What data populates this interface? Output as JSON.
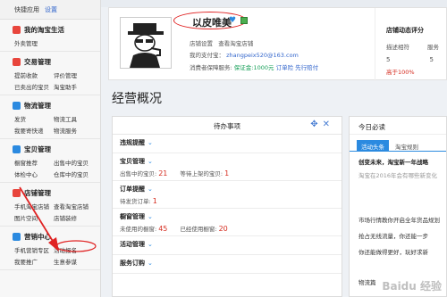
{
  "sidebar": {
    "quick_label": "快捷应用",
    "quick_link": "设置",
    "sections": [
      {
        "title": "我的淘宝生活",
        "color": "#e8453c",
        "items": [
          "外卖管理"
        ]
      },
      {
        "title": "交易管理",
        "color": "#e8453c",
        "items": [
          "提前收款",
          "评价管理",
          "已卖出的宝贝",
          "淘宝助手"
        ]
      },
      {
        "title": "物流管理",
        "color": "#2b8ae0",
        "items": [
          "发货",
          "物流工具",
          "我要寄快递",
          "物流服务"
        ]
      },
      {
        "title": "宝贝管理",
        "color": "#2b8ae0",
        "items": [
          "橱窗推荐",
          "出售中的宝贝",
          "体检中心",
          "仓库中的宝贝"
        ]
      },
      {
        "title": "店铺管理",
        "color": "#e8453c",
        "items": [
          "手机淘宝店铺",
          "查看淘宝店铺",
          "图片空间",
          "店铺装修"
        ]
      },
      {
        "title": "营销中心",
        "color": "#2b8ae0",
        "items": [
          "手机营销专区",
          "活动报名",
          "我要推广",
          "生意参谋"
        ]
      }
    ]
  },
  "profile": {
    "shop_name": "以皮唯美",
    "settings_link": "店铺设置",
    "view_shop_link": "查看淘宝店铺",
    "alipay_label": "我的支付宝：",
    "alipay_account": "zhangpeix520@163.com",
    "deposit_label": "消费者保障服务:",
    "deposit_value": "保证金:1000元",
    "return_label": "订单险",
    "fast_label": "先行赔付"
  },
  "rating": {
    "title": "店铺动态评分",
    "col1": "描述相符",
    "col2": "服务",
    "val1": "5",
    "val2": "5",
    "higher": "高于100%"
  },
  "main": {
    "title": "经营概况"
  },
  "todo": {
    "title": "待办事项",
    "sections": [
      {
        "title": "违规提醒",
        "rows": []
      },
      {
        "title": "宝贝管理",
        "rows": [
          {
            "label": "出售中的宝贝:",
            "value": "21"
          },
          {
            "label": "等待上架的宝贝:",
            "value": "1"
          }
        ]
      },
      {
        "title": "订单提醒",
        "rows": [
          {
            "label": "待发货订单:",
            "value": "1"
          }
        ]
      },
      {
        "title": "橱窗管理",
        "rows": [
          {
            "label": "未使用的橱窗:",
            "value": "45"
          },
          {
            "label": "已经使用橱窗:",
            "value": "20"
          }
        ]
      },
      {
        "title": "活动管理",
        "rows": []
      },
      {
        "title": "服务订购",
        "rows": []
      }
    ]
  },
  "knowledge": {
    "title": "今日必读",
    "tabs": [
      "活动头条",
      "淘宝规则"
    ],
    "lines": [
      "创变未来，淘宝新一年战略",
      "淘宝在2016年会有哪些新变化",
      "市场行情教你开启全年货品规划",
      "抢占无线流量，你还能一步",
      "你还能做得更好，玩好求新",
      "物流篇"
    ]
  },
  "watermark": "Baidu 经验",
  "colors": {
    "accent": "#2b8ae0",
    "alert": "#d52b1e",
    "annotation": "#e02222"
  }
}
